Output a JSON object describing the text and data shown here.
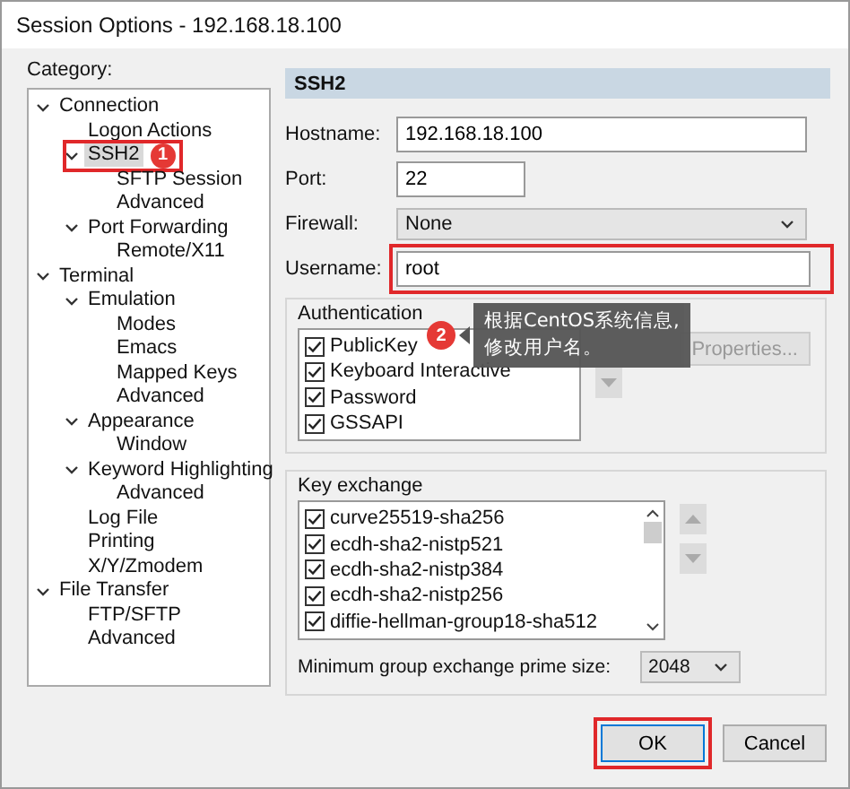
{
  "window": {
    "title": "Session Options - 192.168.18.100"
  },
  "category_label": "Category:",
  "tree": [
    {
      "label": "Connection",
      "expanded": true,
      "selected": false,
      "children": [
        {
          "label": "Logon Actions",
          "selected": false
        },
        {
          "label": "SSH2",
          "expanded": true,
          "selected": true,
          "badge": "1",
          "children": [
            {
              "label": "SFTP Session",
              "selected": false
            },
            {
              "label": "Advanced",
              "selected": false
            }
          ]
        },
        {
          "label": "Port Forwarding",
          "expanded": true,
          "selected": false,
          "children": [
            {
              "label": "Remote/X11",
              "selected": false
            }
          ]
        }
      ]
    },
    {
      "label": "Terminal",
      "expanded": true,
      "selected": false,
      "children": [
        {
          "label": "Emulation",
          "expanded": true,
          "selected": false,
          "children": [
            {
              "label": "Modes",
              "selected": false
            },
            {
              "label": "Emacs",
              "selected": false
            },
            {
              "label": "Mapped Keys",
              "selected": false
            },
            {
              "label": "Advanced",
              "selected": false
            }
          ]
        },
        {
          "label": "Appearance",
          "expanded": true,
          "selected": false,
          "children": [
            {
              "label": "Window",
              "selected": false
            }
          ]
        },
        {
          "label": "Keyword Highlighting",
          "expanded": true,
          "selected": false,
          "children": [
            {
              "label": "Advanced",
              "selected": false
            }
          ]
        },
        {
          "label": "Log File",
          "selected": false
        },
        {
          "label": "Printing",
          "selected": false
        },
        {
          "label": "X/Y/Zmodem",
          "selected": false
        }
      ]
    },
    {
      "label": "File Transfer",
      "expanded": true,
      "selected": false,
      "children": [
        {
          "label": "FTP/SFTP",
          "selected": false
        },
        {
          "label": "Advanced",
          "selected": false
        }
      ]
    }
  ],
  "section_title": "SSH2",
  "fields": [
    {
      "kind": "text",
      "label": "Hostname:",
      "value": "192.168.18.100",
      "highlighted": false
    },
    {
      "kind": "short",
      "label": "Port:",
      "value": "22",
      "highlighted": false
    },
    {
      "kind": "dropdown",
      "label": "Firewall:",
      "value": "None",
      "highlighted": false
    },
    {
      "kind": "text",
      "label": "Username:",
      "value": "root",
      "highlighted": true
    }
  ],
  "authentication": {
    "title": "Authentication",
    "methods": [
      {
        "label": "PublicKey",
        "checked": true
      },
      {
        "label": "Keyboard Interactive",
        "checked": true
      },
      {
        "label": "Password",
        "checked": true
      },
      {
        "label": "GSSAPI",
        "checked": true
      }
    ],
    "properties_button": "Properties..."
  },
  "tooltip": {
    "badge": "2",
    "lines": [
      "根据CentOS系统信息,",
      "修改用户名。"
    ]
  },
  "key_exchange": {
    "title": "Key exchange",
    "items": [
      {
        "label": "curve25519-sha256",
        "checked": true
      },
      {
        "label": "ecdh-sha2-nistp521",
        "checked": true
      },
      {
        "label": "ecdh-sha2-nistp384",
        "checked": true
      },
      {
        "label": "ecdh-sha2-nistp256",
        "checked": true
      },
      {
        "label": "diffie-hellman-group18-sha512",
        "checked": true
      }
    ],
    "min_prime_label": "Minimum group exchange prime size:",
    "min_prime_value": "2048"
  },
  "buttons": [
    {
      "label": "OK",
      "highlighted": true
    },
    {
      "label": "Cancel",
      "highlighted": false
    }
  ]
}
